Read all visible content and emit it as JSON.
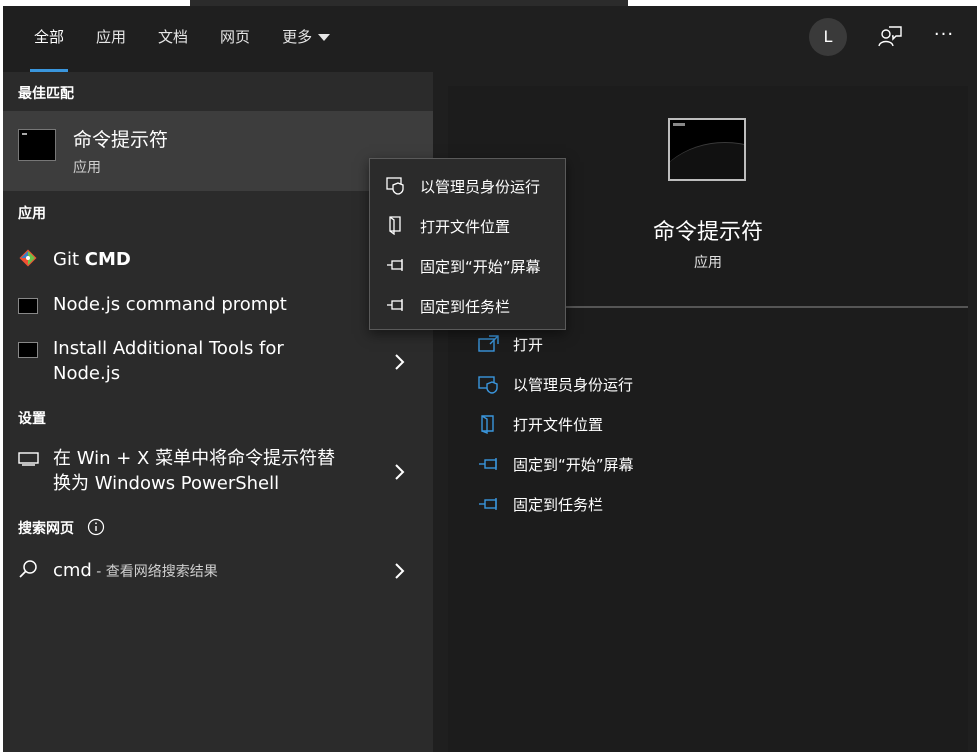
{
  "tabs": [
    {
      "label": "全部",
      "active": true
    },
    {
      "label": "应用",
      "active": false
    },
    {
      "label": "文档",
      "active": false
    },
    {
      "label": "网页",
      "active": false
    },
    {
      "label": "更多",
      "active": false
    }
  ],
  "header": {
    "avatar_letter": "L",
    "more_label": "···"
  },
  "left": {
    "best_match_heading": "最佳匹配",
    "best_match": {
      "title": "命令提示符",
      "subtitle": "应用",
      "icon": "terminal-icon"
    },
    "apps_heading": "应用",
    "apps": [
      {
        "label_prefix": "Git ",
        "label_bold": "CMD",
        "icon": "git-icon"
      },
      {
        "label": "Node.js command prompt",
        "icon": "terminal-icon"
      },
      {
        "label_line1": "Install Additional Tools for",
        "label_line2": "Node.js",
        "icon": "terminal-icon"
      }
    ],
    "settings_heading": "设置",
    "settings": [
      {
        "label_line1": "在 Win + X 菜单中将命令提示符替",
        "label_line2": "换为 Windows PowerShell",
        "icon": "monitor-icon"
      }
    ],
    "web_heading": "搜索网页",
    "web": {
      "query": "cmd",
      "suffix": " - 查看网络搜索结果",
      "icon": "search-icon"
    }
  },
  "right": {
    "title": "命令提示符",
    "subtitle": "应用",
    "actions": [
      {
        "label": "打开",
        "icon": "open-icon"
      },
      {
        "label": "以管理员身份运行",
        "icon": "shield-icon"
      },
      {
        "label": "打开文件位置",
        "icon": "file-location-icon"
      },
      {
        "label": "固定到“开始”屏幕",
        "icon": "pin-icon"
      },
      {
        "label": "固定到任务栏",
        "icon": "pin-icon"
      }
    ]
  },
  "context_menu": {
    "items": [
      {
        "label": "以管理员身份运行",
        "icon": "shield-icon"
      },
      {
        "label": "打开文件位置",
        "icon": "file-location-icon"
      },
      {
        "label": "固定到“开始”屏幕",
        "icon": "pin-icon"
      },
      {
        "label": "固定到任务栏",
        "icon": "pin-icon"
      }
    ]
  },
  "colors": {
    "accent": "#3a96dd",
    "panel": "#2b2b2b",
    "right_panel": "#1c1c1c",
    "selected": "#3d3d3d"
  }
}
